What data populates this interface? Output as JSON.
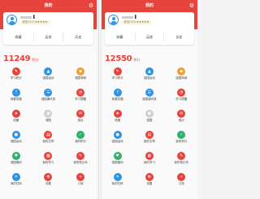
{
  "screens": [
    {
      "header_title": "我的",
      "user_name": "▌",
      "badge": "积分 5.0 ★★★★★",
      "stats": [
        "收藏",
        "足迹",
        "历史"
      ],
      "points_value": "11249",
      "points_unit": "积分",
      "grid": [
        {
          "label": "学习积分",
          "color": "#e8423c",
          "icon": "history-icon"
        },
        {
          "label": "强国运动",
          "color": "#2f93e6",
          "icon": "run-icon"
        },
        {
          "label": "强国商城",
          "color": "#f0a030",
          "icon": "shop-icon"
        },
        {
          "label": "我要答题",
          "color": "#2f93e6",
          "icon": "quiz-icon"
        },
        {
          "label": "强国通讯录",
          "color": "#2f93e6",
          "icon": "contacts-icon"
        },
        {
          "label": "学习提醒",
          "color": "#e8423c",
          "icon": "reminder-icon"
        },
        {
          "label": "收藏",
          "color": "#e8423c",
          "icon": "favorite-icon"
        },
        {
          "label": "强国",
          "color": "#cfcfcf",
          "icon": "image-icon"
        },
        {
          "label": "观点",
          "color": "#e8423c",
          "icon": "opinion-icon"
        },
        {
          "label": "强国运动",
          "color": "#2f93e6",
          "icon": "sport-icon"
        },
        {
          "label": "我的文章",
          "color": "#e8423c",
          "icon": "article-icon"
        },
        {
          "label": "我的积分",
          "color": "#2fb16a",
          "icon": "points-icon"
        },
        {
          "label": "强国福利",
          "color": "#2fb16a",
          "icon": "welfare-icon"
        },
        {
          "label": "我的学习",
          "color": "#e8423c",
          "icon": "study-icon"
        },
        {
          "label": "我的笔记本",
          "color": "#e8423c",
          "icon": "notebook-icon"
        },
        {
          "label": "我的扫码",
          "color": "#2f93e6",
          "icon": "scan-icon"
        },
        {
          "label": "设置",
          "color": "#e8423c",
          "icon": "settings-icon"
        },
        {
          "label": "订阅",
          "color": "#e8423c",
          "icon": "subscribe-icon"
        }
      ]
    },
    {
      "header_title": "我的",
      "user_name": "▌",
      "badge": "积分 5.0 ★★★★★",
      "stats": [
        "收藏",
        "足迹",
        "历史"
      ],
      "points_value": "12550",
      "points_unit": "积分",
      "grid": [
        {
          "label": "学习积分",
          "color": "#e8423c",
          "icon": "history-icon"
        },
        {
          "label": "强国运动",
          "color": "#2f93e6",
          "icon": "run-icon"
        },
        {
          "label": "强国商城",
          "color": "#f0a030",
          "icon": "shop-icon"
        },
        {
          "label": "我要答题",
          "color": "#2f93e6",
          "icon": "quiz-icon"
        },
        {
          "label": "强国通讯录",
          "color": "#2f93e6",
          "icon": "contacts-icon"
        },
        {
          "label": "学习提醒",
          "color": "#e8423c",
          "icon": "reminder-icon"
        },
        {
          "label": "收藏",
          "color": "#e8423c",
          "icon": "favorite-icon"
        },
        {
          "label": "强国",
          "color": "#cfcfcf",
          "icon": "image-icon"
        },
        {
          "label": "观点",
          "color": "#e8423c",
          "icon": "opinion-icon"
        },
        {
          "label": "强国运动",
          "color": "#2f93e6",
          "icon": "sport-icon"
        },
        {
          "label": "我的文章",
          "color": "#e8423c",
          "icon": "article-icon"
        },
        {
          "label": "我的积分",
          "color": "#2fb16a",
          "icon": "points-icon"
        },
        {
          "label": "强国福利",
          "color": "#2fb16a",
          "icon": "welfare-icon"
        },
        {
          "label": "我的学习",
          "color": "#e8423c",
          "icon": "study-icon"
        },
        {
          "label": "我的笔记本",
          "color": "#e8423c",
          "icon": "notebook-icon"
        },
        {
          "label": "我的扫码",
          "color": "#2f93e6",
          "icon": "scan-icon"
        },
        {
          "label": "设置",
          "color": "#e8423c",
          "icon": "settings-icon"
        },
        {
          "label": "订阅",
          "color": "#e8423c",
          "icon": "subscribe-icon"
        }
      ]
    }
  ]
}
